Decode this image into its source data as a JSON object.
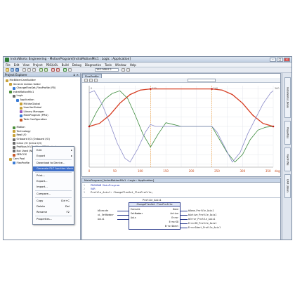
{
  "window": {
    "title": "IndraWorks Engineering - MotionProgram[IndraMotionMlc1 : Logic : Application]"
  },
  "menu": [
    "File",
    "Edit",
    "View",
    "Project",
    "PBG/LOL",
    "Build",
    "Debug",
    "Diagnostics",
    "Tools",
    "Window",
    "Help"
  ],
  "toolbar": {
    "field_value": "192.168.0.2"
  },
  "explorer": {
    "title": "Project Explorer",
    "tree": [
      {
        "label": "MlcBilderCamBuilder",
        "indent": 0,
        "color": "#c8a23a"
      },
      {
        "label": "General motion folder",
        "indent": 1,
        "color": "#c8a23a"
      },
      {
        "label": "ChangeFlexSet_FlexProfile (FB)",
        "indent": 2,
        "color": "#3a7bd5"
      },
      {
        "label": "IndraMotionMlc1",
        "indent": 1,
        "color": "#4a8f3a"
      },
      {
        "label": "Logic",
        "indent": 2,
        "color": "#6a6a6a"
      },
      {
        "label": "Application",
        "indent": 3,
        "color": "#3a7bd5"
      },
      {
        "label": "MlcVarGlobal",
        "indent": 4,
        "color": "#c8a23a"
      },
      {
        "label": "UserVarGlobal",
        "indent": 4,
        "color": "#c8a23a"
      },
      {
        "label": "Library Manager",
        "indent": 4,
        "color": "#9a5bbf"
      },
      {
        "label": "MainProgram (PRG)",
        "indent": 4,
        "color": "#3a7bd5"
      },
      {
        "label": "Task Configuration",
        "indent": 4,
        "color": "#c85a2a"
      },
      {
        "label": "",
        "indent": 0,
        "color": ""
      },
      {
        "label": "Motion",
        "indent": 2,
        "color": "#4a8f3a"
      },
      {
        "label": "Technology",
        "indent": 2,
        "color": "#c8a23a"
      },
      {
        "label": "Real I/O",
        "indent": 2,
        "color": "#c8a23a"
      },
      {
        "label": "Onboard I/O (Onboard I/O)",
        "indent": 2,
        "color": "#6a6a6a"
      },
      {
        "label": "Inline I/O (Inline I/O)",
        "indent": 2,
        "color": "#6a6a6a"
      },
      {
        "label": "Profibus M (Profibus DP Master)",
        "indent": 2,
        "color": "#6a6a6a"
      },
      {
        "label": "Not Used (Not Used)",
        "indent": 2,
        "color": "#6a6a6a"
      },
      {
        "label": "SERCOS",
        "indent": 2,
        "color": "#c85a2a"
      },
      {
        "label": "Cam Pool",
        "indent": 1,
        "color": "#c8a23a"
      },
      {
        "label": "FlexProfile",
        "indent": 2,
        "color": "#3a7bd5"
      }
    ]
  },
  "context_menu": {
    "items": [
      {
        "label": "Edit",
        "shortcut": "",
        "arrow": true,
        "highlight": false
      },
      {
        "label": "Export",
        "shortcut": "",
        "arrow": true,
        "highlight": false
      },
      {
        "label": "Download to Device...",
        "shortcut": "",
        "arrow": false,
        "highlight": false
      },
      {
        "label": "Generate PLC function block",
        "shortcut": "",
        "arrow": false,
        "highlight": true
      },
      {
        "label": "Print...",
        "shortcut": "",
        "arrow": false,
        "highlight": false
      },
      {
        "label": "Export...",
        "shortcut": "",
        "arrow": false,
        "highlight": false
      },
      {
        "label": "Import...",
        "shortcut": "",
        "arrow": false,
        "highlight": false
      },
      {
        "label": "Compare...",
        "shortcut": "",
        "arrow": false,
        "highlight": false
      },
      {
        "label": "Copy",
        "shortcut": "Ctrl+C",
        "arrow": false,
        "highlight": false
      },
      {
        "label": "Delete",
        "shortcut": "Del",
        "arrow": false,
        "highlight": false
      },
      {
        "label": "Rename",
        "shortcut": "F2",
        "arrow": false,
        "highlight": false
      },
      {
        "label": "Properties...",
        "shortcut": "",
        "arrow": false,
        "highlight": false
      }
    ]
  },
  "chart_pane": {
    "tab": "FlexProfile",
    "field": "",
    "x_ticks": [
      "0",
      "50",
      "100",
      "150",
      "200",
      "250",
      "300",
      "350"
    ],
    "x_unit": "deg",
    "marker_labels": [
      "0",
      "120",
      "240",
      "360"
    ]
  },
  "chart_data": {
    "type": "line",
    "x_range": [
      0,
      360
    ],
    "series": [
      {
        "color": "#d63a1f",
        "points": [
          [
            0,
            0
          ],
          [
            20,
            0.08
          ],
          [
            40,
            0.3
          ],
          [
            60,
            0.62
          ],
          [
            80,
            0.85
          ],
          [
            100,
            0.97
          ],
          [
            120,
            1
          ],
          [
            240,
            1
          ],
          [
            260,
            0.97
          ],
          [
            280,
            0.85
          ],
          [
            300,
            0.62
          ],
          [
            320,
            0.3
          ],
          [
            340,
            0.08
          ],
          [
            360,
            0
          ]
        ]
      },
      {
        "color": "#3b8a3b",
        "points": [
          [
            0,
            0
          ],
          [
            15,
            0.4
          ],
          [
            30,
            0.72
          ],
          [
            45,
            0.88
          ],
          [
            60,
            0.95
          ],
          [
            75,
            0.75
          ],
          [
            90,
            0.3
          ],
          [
            105,
            -0.2
          ],
          [
            120,
            -0.55
          ],
          [
            135,
            -0.2
          ],
          [
            150,
            0.1
          ],
          [
            165,
            0.05
          ],
          [
            180,
            0
          ],
          [
            240,
            0
          ],
          [
            255,
            -0.35
          ],
          [
            270,
            -0.7
          ],
          [
            285,
            -0.95
          ],
          [
            300,
            -0.75
          ],
          [
            315,
            -0.35
          ],
          [
            330,
            -0.1
          ],
          [
            345,
            -0.02
          ],
          [
            360,
            0
          ]
        ]
      },
      {
        "color": "#8a8ac8",
        "points": [
          [
            0,
            0.9
          ],
          [
            10,
            0.95
          ],
          [
            25,
            0.6
          ],
          [
            40,
            0.1
          ],
          [
            55,
            -0.45
          ],
          [
            70,
            -0.85
          ],
          [
            80,
            -0.95
          ],
          [
            95,
            -0.6
          ],
          [
            110,
            -0.15
          ],
          [
            120,
            0.05
          ],
          [
            130,
            0
          ],
          [
            240,
            0
          ],
          [
            250,
            -0.15
          ],
          [
            265,
            -0.55
          ],
          [
            280,
            -0.95
          ],
          [
            295,
            -0.7
          ],
          [
            310,
            -0.2
          ],
          [
            325,
            0.2
          ],
          [
            340,
            0.6
          ],
          [
            355,
            0.9
          ],
          [
            360,
            0.95
          ]
        ]
      }
    ]
  },
  "code_pane": {
    "header": "MainProgram [IndraMotionMlc1 : Logic : Application]",
    "lines": [
      "PROGRAM MainProgram",
      "VAR",
      "    Profile_Axis1: ChangeFlexSet_FlexProfile;"
    ],
    "line_numbers": [
      "1",
      "2",
      "3"
    ],
    "fb_instance": "Profile_Axis1",
    "fb_type": "ChangeFlexSet FlexProfile",
    "fb_inputs": [
      "Execute",
      "SetNumber",
      "Axis"
    ],
    "fb_outputs": [
      "Done",
      "Active",
      "Error",
      "ErrorID",
      "ErrorIdent"
    ],
    "in_vars": [
      "bExecute",
      "ui_SetNumber",
      "Axis1"
    ],
    "out_vars": [
      "bDone_Profile_Axis1",
      "bActive_Profile_Axis1",
      "bError_Profile_Axis1",
      "ErrorID_Profile_Axis1",
      "ErrorIdent_Profile_Axis1"
    ]
  },
  "side_tabs": [
    "IndraWorks Library",
    "Properties",
    "FlexProfile",
    "CAM Library"
  ]
}
